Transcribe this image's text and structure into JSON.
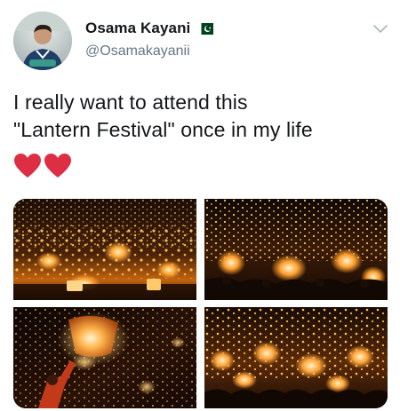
{
  "user": {
    "display_name": "Osama Kayani",
    "handle": "@Osamakayanii",
    "flag_icon": "pakistan-flag-icon"
  },
  "tweet": {
    "text_line1": "I really want to attend this",
    "text_line2": "\"Lantern Festival\" once in my life",
    "emoji": [
      "red-heart-icon",
      "red-heart-icon"
    ]
  },
  "menu_icon": "chevron-down-icon",
  "media": [
    {
      "alt_icon": "lantern-festival-photo-1"
    },
    {
      "alt_icon": "lantern-festival-photo-2"
    },
    {
      "alt_icon": "lantern-festival-photo-3"
    },
    {
      "alt_icon": "lantern-festival-photo-4"
    }
  ],
  "colors": {
    "text_primary": "#14171a",
    "text_secondary": "#657786",
    "heart_red": "#dd2e44",
    "flag_green": "#01411c",
    "lantern_glow": "#ffb347"
  }
}
